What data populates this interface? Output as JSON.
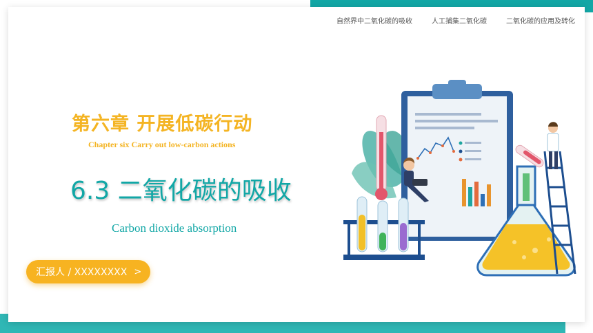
{
  "nav": {
    "items": [
      "自然界中二氧化碳的吸收",
      "人工捕集二氧化碳",
      "二氧化碳的应用及转化"
    ]
  },
  "chapter": {
    "title": "第六章  开展低碳行动",
    "subtitle": "Chapter six  Carry out low-carbon actions"
  },
  "lesson": {
    "title": "6.3 二氧化碳的吸收",
    "subtitle": "Carbon dioxide absorption"
  },
  "reporter": {
    "label": "汇报人 / XXXXXXXX",
    "chevron": ">"
  },
  "colors": {
    "teal": "#12a7a6",
    "yellow": "#f4b423",
    "navy": "#1d4e8f"
  },
  "illustration": {
    "icon": "chemistry-lab-icon"
  }
}
